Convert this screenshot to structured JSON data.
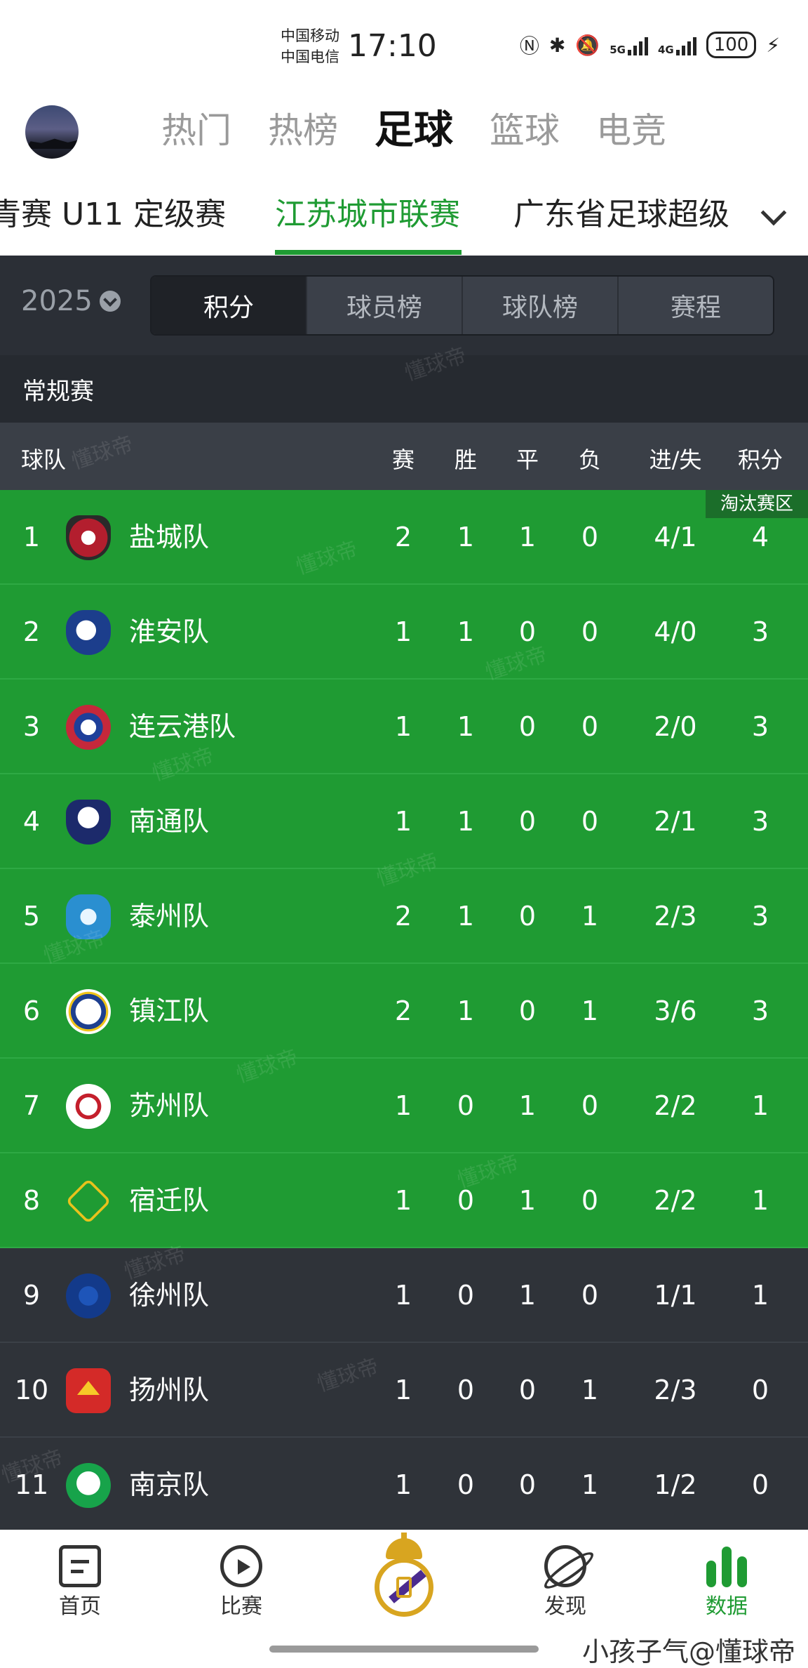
{
  "status_bar": {
    "carrier_1": "中国移动",
    "carrier_2": "中国电信",
    "time": "17:10",
    "battery": "100",
    "network_1": "5G",
    "network_2": "4G"
  },
  "top_nav": {
    "tabs": [
      {
        "label": "热门",
        "active": false
      },
      {
        "label": "热榜",
        "active": false
      },
      {
        "label": "足球",
        "active": true
      },
      {
        "label": "篮球",
        "active": false
      },
      {
        "label": "电竞",
        "active": false
      }
    ]
  },
  "league_tabs": [
    {
      "label": "青赛 U11 定级赛",
      "active": false
    },
    {
      "label": "江苏城市联赛",
      "active": true
    },
    {
      "label": "广东省足球超级",
      "active": false
    }
  ],
  "season": {
    "label": "2025"
  },
  "segment_tabs": [
    {
      "label": "积分",
      "active": true
    },
    {
      "label": "球员榜",
      "active": false
    },
    {
      "label": "球队榜",
      "active": false
    },
    {
      "label": "赛程",
      "active": false
    }
  ],
  "section": {
    "title": "常规赛"
  },
  "table": {
    "headers": {
      "team": "球队",
      "played": "赛",
      "won": "胜",
      "drawn": "平",
      "lost": "负",
      "goals": "进/失",
      "points": "积分"
    },
    "zone_label": "淘汰赛区",
    "rows": [
      {
        "rank": "1",
        "team": "盐城队",
        "played": "2",
        "won": "1",
        "drawn": "1",
        "lost": "0",
        "goals": "4/1",
        "points": "4",
        "qualified": true,
        "logo": "yancheng"
      },
      {
        "rank": "2",
        "team": "淮安队",
        "played": "1",
        "won": "1",
        "drawn": "0",
        "lost": "0",
        "goals": "4/0",
        "points": "3",
        "qualified": true,
        "logo": "huaian"
      },
      {
        "rank": "3",
        "team": "连云港队",
        "played": "1",
        "won": "1",
        "drawn": "0",
        "lost": "0",
        "goals": "2/0",
        "points": "3",
        "qualified": true,
        "logo": "lianyungang"
      },
      {
        "rank": "4",
        "team": "南通队",
        "played": "1",
        "won": "1",
        "drawn": "0",
        "lost": "0",
        "goals": "2/1",
        "points": "3",
        "qualified": true,
        "logo": "nantong"
      },
      {
        "rank": "5",
        "team": "泰州队",
        "played": "2",
        "won": "1",
        "drawn": "0",
        "lost": "1",
        "goals": "2/3",
        "points": "3",
        "qualified": true,
        "logo": "taizhou"
      },
      {
        "rank": "6",
        "team": "镇江队",
        "played": "2",
        "won": "1",
        "drawn": "0",
        "lost": "1",
        "goals": "3/6",
        "points": "3",
        "qualified": true,
        "logo": "zhenjiang"
      },
      {
        "rank": "7",
        "team": "苏州队",
        "played": "1",
        "won": "0",
        "drawn": "1",
        "lost": "0",
        "goals": "2/2",
        "points": "1",
        "qualified": true,
        "logo": "suzhou"
      },
      {
        "rank": "8",
        "team": "宿迁队",
        "played": "1",
        "won": "0",
        "drawn": "1",
        "lost": "0",
        "goals": "2/2",
        "points": "1",
        "qualified": true,
        "logo": "suqian"
      },
      {
        "rank": "9",
        "team": "徐州队",
        "played": "1",
        "won": "0",
        "drawn": "1",
        "lost": "0",
        "goals": "1/1",
        "points": "1",
        "qualified": false,
        "logo": "xuzhou"
      },
      {
        "rank": "10",
        "team": "扬州队",
        "played": "1",
        "won": "0",
        "drawn": "0",
        "lost": "1",
        "goals": "2/3",
        "points": "0",
        "qualified": false,
        "logo": "yangzhou"
      },
      {
        "rank": "11",
        "team": "南京队",
        "played": "1",
        "won": "0",
        "drawn": "0",
        "lost": "1",
        "goals": "1/2",
        "points": "0",
        "qualified": false,
        "logo": "nanjing"
      }
    ]
  },
  "watermark": "懂球帝",
  "bottom_nav": {
    "items": [
      {
        "label": "首页",
        "icon": "document-icon",
        "active": false
      },
      {
        "label": "比赛",
        "icon": "play-icon",
        "active": false
      },
      {
        "label": "",
        "icon": "club-crest-icon",
        "active": false
      },
      {
        "label": "发现",
        "icon": "planet-icon",
        "active": false
      },
      {
        "label": "数据",
        "icon": "bar-chart-icon",
        "active": true
      }
    ]
  },
  "footer_watermark": "小孩子气@懂球帝",
  "colors": {
    "accent": "#1f9b33",
    "panel": "#2b2f36",
    "qualified_row": "#1f9b33",
    "normal_row": "#2f3339"
  }
}
